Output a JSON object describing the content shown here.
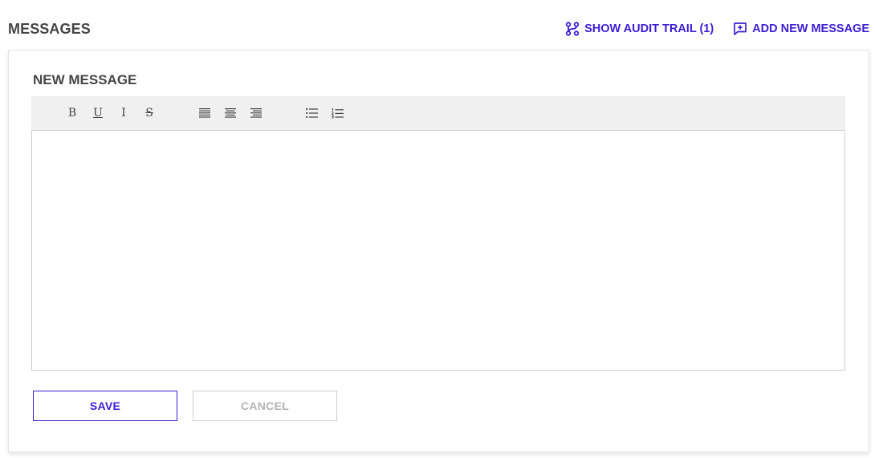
{
  "header": {
    "title": "MESSAGES",
    "audit_trail_label": "SHOW AUDIT TRAIL (1)",
    "audit_trail_icon": "branch-icon",
    "add_message_label": "ADD NEW MESSAGE",
    "add_message_icon": "message-plus-icon",
    "accent_color": "#3a1ed4"
  },
  "card": {
    "title": "NEW MESSAGE"
  },
  "toolbar": {
    "bold": "B",
    "underline": "U",
    "italic": "I",
    "strike": "S",
    "align_left_icon": "align-left-icon",
    "align_center_icon": "align-center-icon",
    "align_right_icon": "align-right-icon",
    "bullet_list_icon": "bullet-list-icon",
    "numbered_list_icon": "numbered-list-icon"
  },
  "editor": {
    "content": ""
  },
  "actions": {
    "save_label": "SAVE",
    "cancel_label": "CANCEL"
  }
}
